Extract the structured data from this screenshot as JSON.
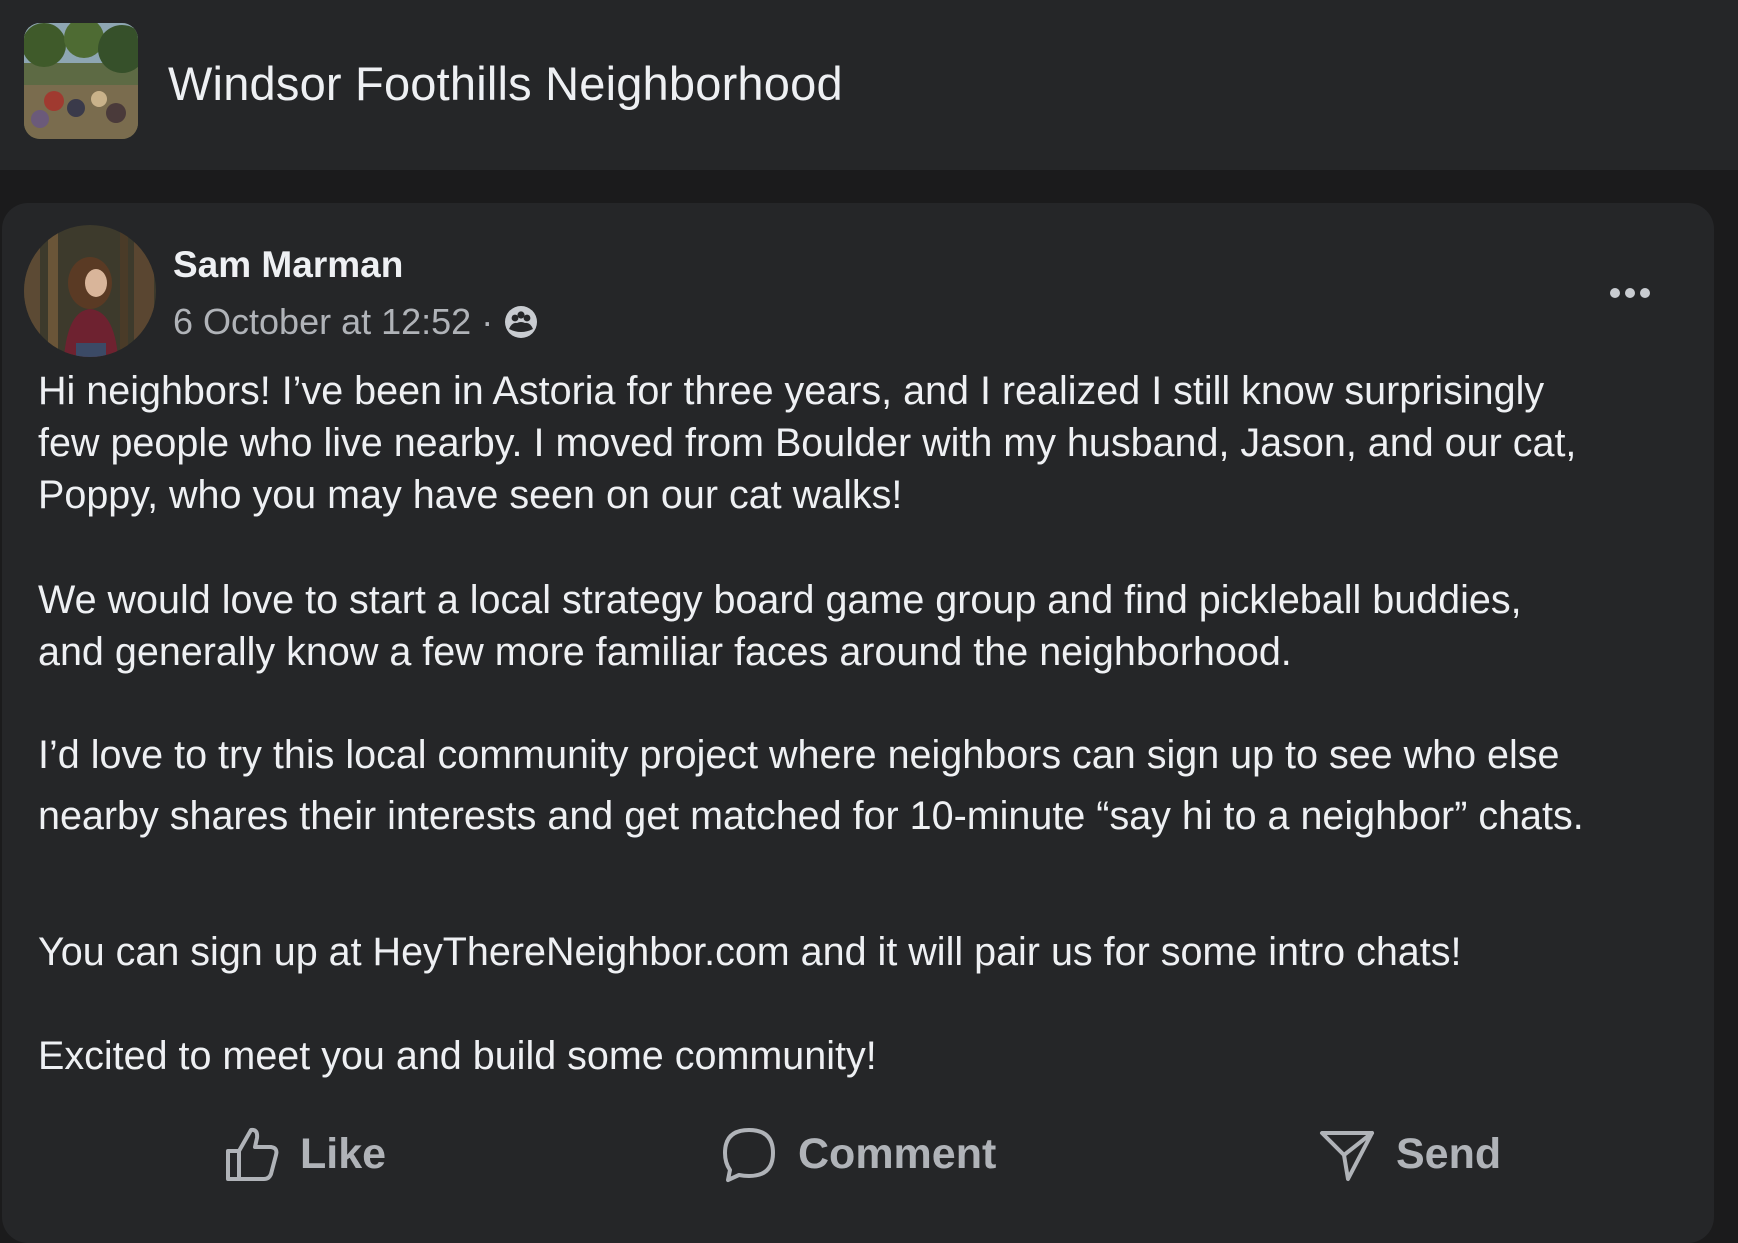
{
  "group": {
    "name": "Windsor Foothills Neighborhood",
    "avatar_icon": "group-photo"
  },
  "post": {
    "author": "Sam Marman",
    "timestamp": "6 October at 12:52",
    "separator": "·",
    "audience_icon": "members-icon",
    "more_icon": "more-options-icon",
    "paragraphs": [
      [
        "Hi neighbors! I’ve been in Astoria for three years, and I realized I still know surprisingly",
        "few people who live nearby. I moved from Boulder with my husband, Jason, and our cat,",
        "Poppy, who you may have seen on our cat walks!"
      ],
      [
        "We would love to start a local strategy board game group and find pickleball buddies,",
        "and generally know a few more familiar faces around the neighborhood."
      ],
      [
        "I’d love to try this local community project where neighbors can sign up to see who else",
        "nearby shares their interests and get matched for 10-minute “say hi to a neighbor” chats."
      ],
      [
        "You can sign up at HeyThereNeighbor.com and it will pair us for some intro chats!"
      ],
      [
        "Excited to meet you and build some community!"
      ]
    ]
  },
  "actions": {
    "like": "Like",
    "comment": "Comment",
    "send": "Send"
  },
  "colors": {
    "background": "#1b1b1c",
    "surface": "#252628",
    "text_primary": "#eef0f3",
    "text_secondary": "#b0b3b8"
  }
}
